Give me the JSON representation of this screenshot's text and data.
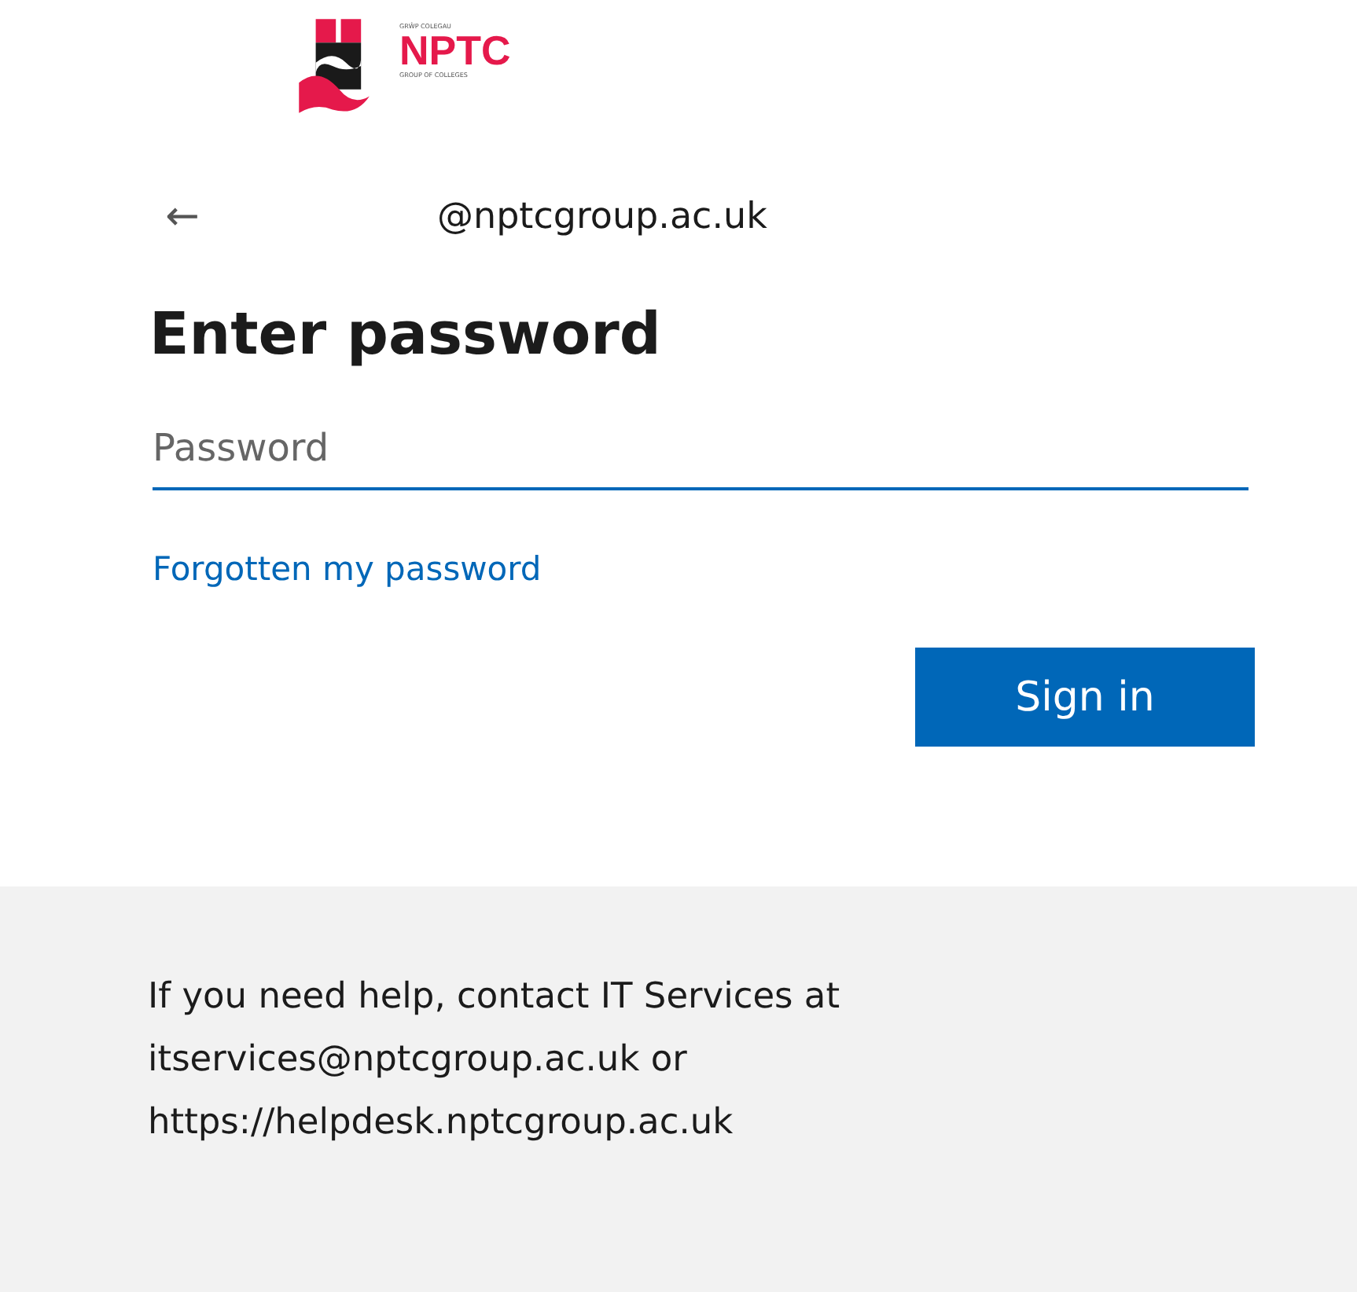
{
  "logo": {
    "top_text": "GRŴP COLEGAU",
    "name": "NPTC",
    "bottom_text": "GROUP OF COLLEGES"
  },
  "identity": {
    "back": "←",
    "email": "@nptcgroup.ac.uk"
  },
  "title": "Enter password",
  "password_field": {
    "placeholder": "Password",
    "focused": true
  },
  "forgot_link": "Forgotten my password",
  "sign_in_button": "Sign in",
  "footer": {
    "text": "If you need help, contact IT Services at itservices@nptcgroup.ac.uk or https://helpdesk.nptcgroup.ac.uk"
  }
}
